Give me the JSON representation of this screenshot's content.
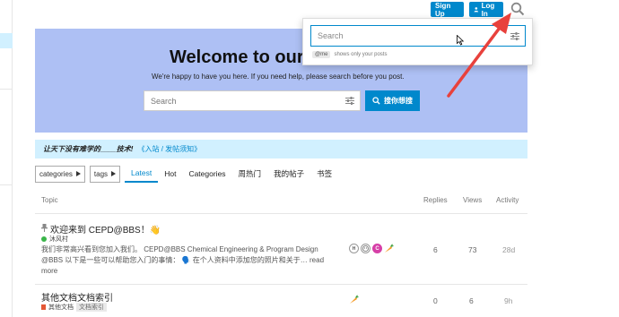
{
  "header": {
    "signup_label": "Sign Up",
    "login_label": "Log In",
    "search_icon": "search-icon"
  },
  "banner": {
    "title": "Welcome to our",
    "subtitle": "We're happy to have you here. If you need help, please search before you post.",
    "search_placeholder": "Search",
    "search_button_label": "搜你想搜"
  },
  "search_panel": {
    "placeholder": "Search",
    "hint_tag": "@me",
    "hint_text": "shows only your posts"
  },
  "notice": {
    "bold_text": "让天下没有难学的____技术!",
    "link_text": "《入站 / 发帖须知》"
  },
  "nav": {
    "categories_dropdown": "categories",
    "tags_dropdown": "tags",
    "items": [
      "Latest",
      "Hot",
      "Categories",
      "周热门",
      "我的帖子",
      "书签"
    ],
    "active": "Latest"
  },
  "table": {
    "headers": {
      "topic": "Topic",
      "replies": "Replies",
      "views": "Views",
      "activity": "Activity"
    },
    "rows": [
      {
        "pinned_icon": "pin-icon",
        "title": "欢迎来到 CEPD@BBS！👋",
        "category": "沐风村",
        "category_color": "#3ab54a",
        "excerpt": "我们非常高兴看到您加入我们。 CEPD@BBS Chemical Engineering & Program Design @BBS 以下是一些可以帮助您入门的事情： 🗣️ 在个人资料中添加您的照片和关于…",
        "read_more": "read more",
        "replies": "6",
        "views": "73",
        "activity": "28d"
      },
      {
        "title": "其他文档文档索引",
        "category": "其他文档",
        "category_color": "#e45735",
        "tag": "文档索引",
        "replies": "0",
        "views": "6",
        "activity": "9h"
      }
    ]
  },
  "colors": {
    "accent": "#0088cc",
    "banner_bg": "#aec0f4",
    "notice_bg": "#d1f0ff",
    "arrow": "#e8413c"
  }
}
